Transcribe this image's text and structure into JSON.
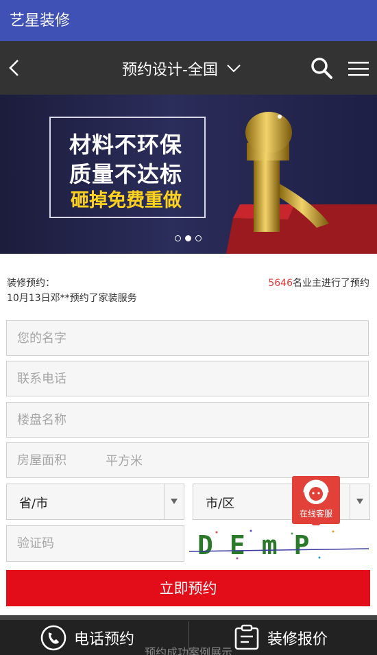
{
  "app": {
    "title": "艺星装修"
  },
  "nav": {
    "title": "预约设计-全国"
  },
  "banner": {
    "line1": "材料不环保",
    "line2": "质量不达标",
    "line3": "砸掉免费重做",
    "active_slide": 2,
    "slide_count": 3
  },
  "info": {
    "label": "装修预约：",
    "recent": "10月13日邓**预约了家装服务",
    "count": "5646",
    "count_suffix": "名业主进行了预约"
  },
  "form": {
    "name_placeholder": "您的名字",
    "phone_placeholder": "联系电话",
    "estate_placeholder": "楼盘名称",
    "area_placeholder": "房屋面积",
    "area_unit": "平方米",
    "province": "省/市",
    "city": "市/区",
    "captcha_placeholder": "验证码",
    "captcha_text": "DEmP",
    "submit": "立即预约"
  },
  "chat": {
    "label": "在线客服"
  },
  "bottom": {
    "phone_label": "电话预约",
    "quote_label": "装修报价",
    "peek_text": "预约成功案例展示"
  },
  "colors": {
    "appbar": "#3f51b5",
    "navbar": "#333333",
    "accent_red": "#e30d1a",
    "count_red": "#e53935"
  }
}
